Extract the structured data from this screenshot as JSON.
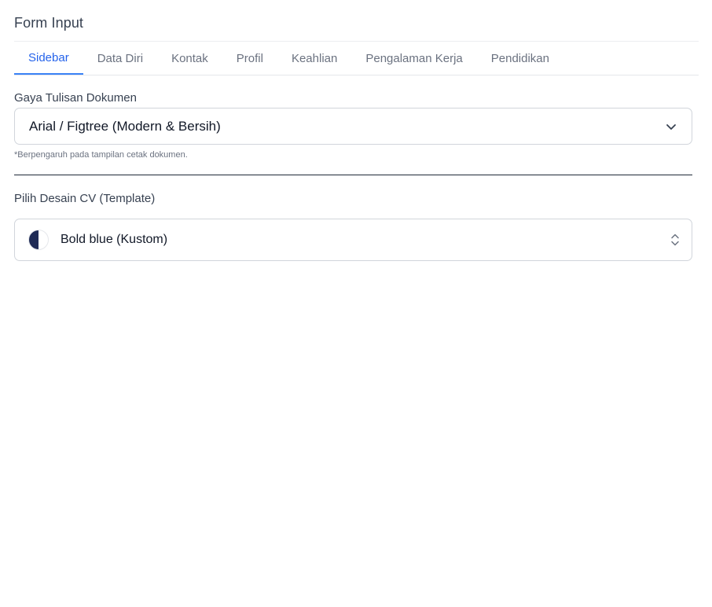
{
  "page": {
    "title": "Form Input"
  },
  "tabs": [
    {
      "label": "Sidebar",
      "active": true
    },
    {
      "label": "Data Diri",
      "active": false
    },
    {
      "label": "Kontak",
      "active": false
    },
    {
      "label": "Profil",
      "active": false
    },
    {
      "label": "Keahlian",
      "active": false
    },
    {
      "label": "Pengalaman Kerja",
      "active": false
    },
    {
      "label": "Pendidikan",
      "active": false
    }
  ],
  "font_field": {
    "label": "Gaya Tulisan Dokumen",
    "value": "Arial / Figtree (Modern & Bersih)",
    "hint": "*Berpengaruh pada tampilan cetak dokumen.",
    "icon": "chevron-down-icon"
  },
  "template_field": {
    "label": "Pilih Desain CV (Template)",
    "value": "Bold blue (Kustom)",
    "swatch_colors": [
      "#1e2a55",
      "#ffffff"
    ],
    "icon": "chevron-up-down-icon"
  },
  "colors": {
    "accent": "#3b82f6",
    "active_tab_text": "#2563eb"
  }
}
